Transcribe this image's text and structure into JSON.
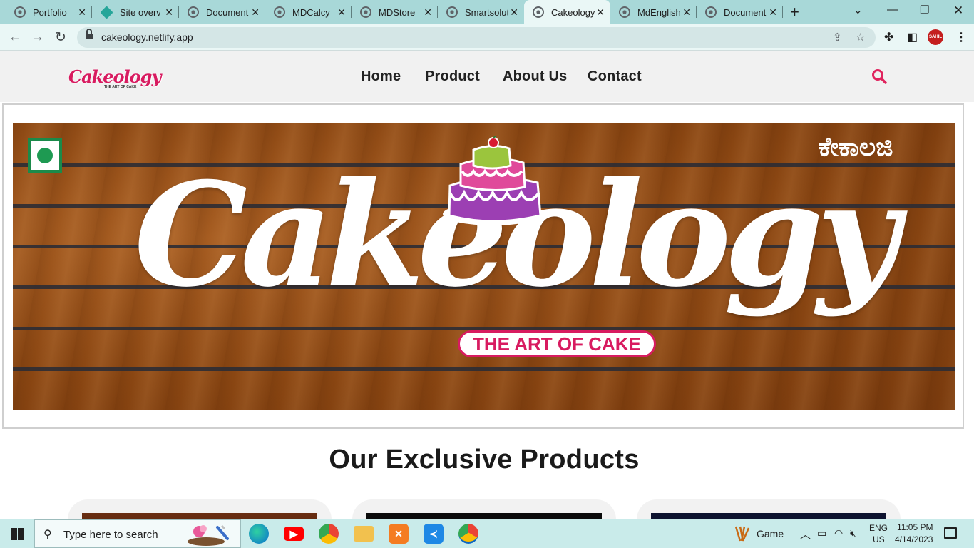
{
  "browser": {
    "tabs": [
      {
        "title": "Portfolio",
        "icon": "globe-icon"
      },
      {
        "title": "Site overview",
        "icon": "netlify-icon"
      },
      {
        "title": "Document",
        "icon": "globe-icon"
      },
      {
        "title": "MDCalcy",
        "icon": "globe-icon"
      },
      {
        "title": "MDStore",
        "icon": "globe-icon"
      },
      {
        "title": "Smartsolutions",
        "icon": "globe-icon"
      },
      {
        "title": "Cakeology",
        "icon": "globe-icon",
        "active": true
      },
      {
        "title": "MdEnglish",
        "icon": "globe-icon"
      },
      {
        "title": "Document",
        "icon": "globe-icon"
      }
    ],
    "tab_close_glyph": "✕",
    "new_tab_glyph": "+",
    "url": "cakeology.netlify.app",
    "profile_label": "SAHIL"
  },
  "site": {
    "logo": {
      "text": "Cakeology",
      "sub": "THE ART OF CAKE"
    },
    "nav": [
      {
        "label": "Home"
      },
      {
        "label": "Product"
      },
      {
        "label": "About Us"
      },
      {
        "label": "Contact"
      }
    ],
    "hero": {
      "brand": "Cakeology",
      "tagline": "THE ART OF CAKE",
      "regional_name": "ಕೇಕಾಲಜಿ"
    },
    "products_heading": "Our Exclusive Products"
  },
  "taskbar": {
    "search_placeholder": "Type here to search",
    "game_label": "Game",
    "lang_top": "ENG",
    "lang_bottom": "US",
    "time": "11:05 PM",
    "date": "4/14/2023"
  },
  "colors": {
    "brand_pink": "#d81b60",
    "tabbar": "#a8d8d8",
    "toolbar": "#eaf7f6",
    "taskbar": "#c9ebea",
    "header_bg": "#f1f1f1"
  }
}
